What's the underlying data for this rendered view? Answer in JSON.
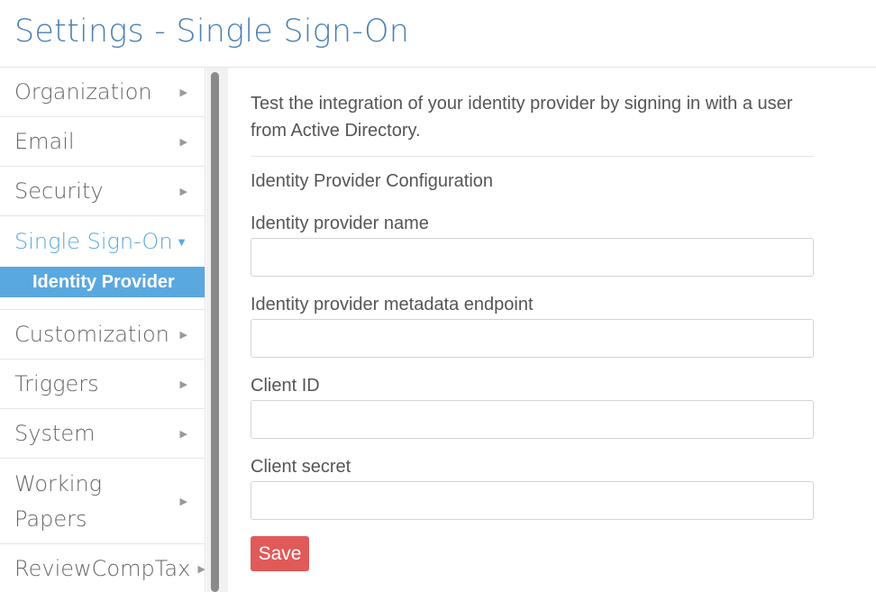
{
  "header": {
    "title": "Settings - Single Sign-On"
  },
  "sidebar": {
    "items": [
      {
        "label": "Organization",
        "arrow": "▶"
      },
      {
        "label": "Email",
        "arrow": "▶"
      },
      {
        "label": "Security",
        "arrow": "▶"
      },
      {
        "label": "Single Sign-On",
        "arrow": "▼"
      },
      {
        "label": "Customization",
        "arrow": "▶"
      },
      {
        "label": "Triggers",
        "arrow": "▶"
      },
      {
        "label": "System",
        "arrow": "▶"
      },
      {
        "label": "Working Papers",
        "line1": "Working",
        "line2": "Papers",
        "arrow": "▶"
      },
      {
        "label": "ReviewCompTax",
        "arrow": "▶"
      }
    ],
    "active_sub_item": {
      "label": "Identity Provider"
    },
    "active_color": "#5aa8e0"
  },
  "main": {
    "intro": "Test the integration of your identity provider by signing in with a user from Active Directory.",
    "section_title": "Identity Provider Configuration",
    "fields": [
      {
        "label": "Identity provider name",
        "value": ""
      },
      {
        "label": "Identity provider metadata endpoint",
        "value": ""
      },
      {
        "label": "Client ID",
        "value": ""
      },
      {
        "label": "Client secret",
        "value": ""
      }
    ],
    "save_label": "Save",
    "save_color": "#e05a5a"
  }
}
